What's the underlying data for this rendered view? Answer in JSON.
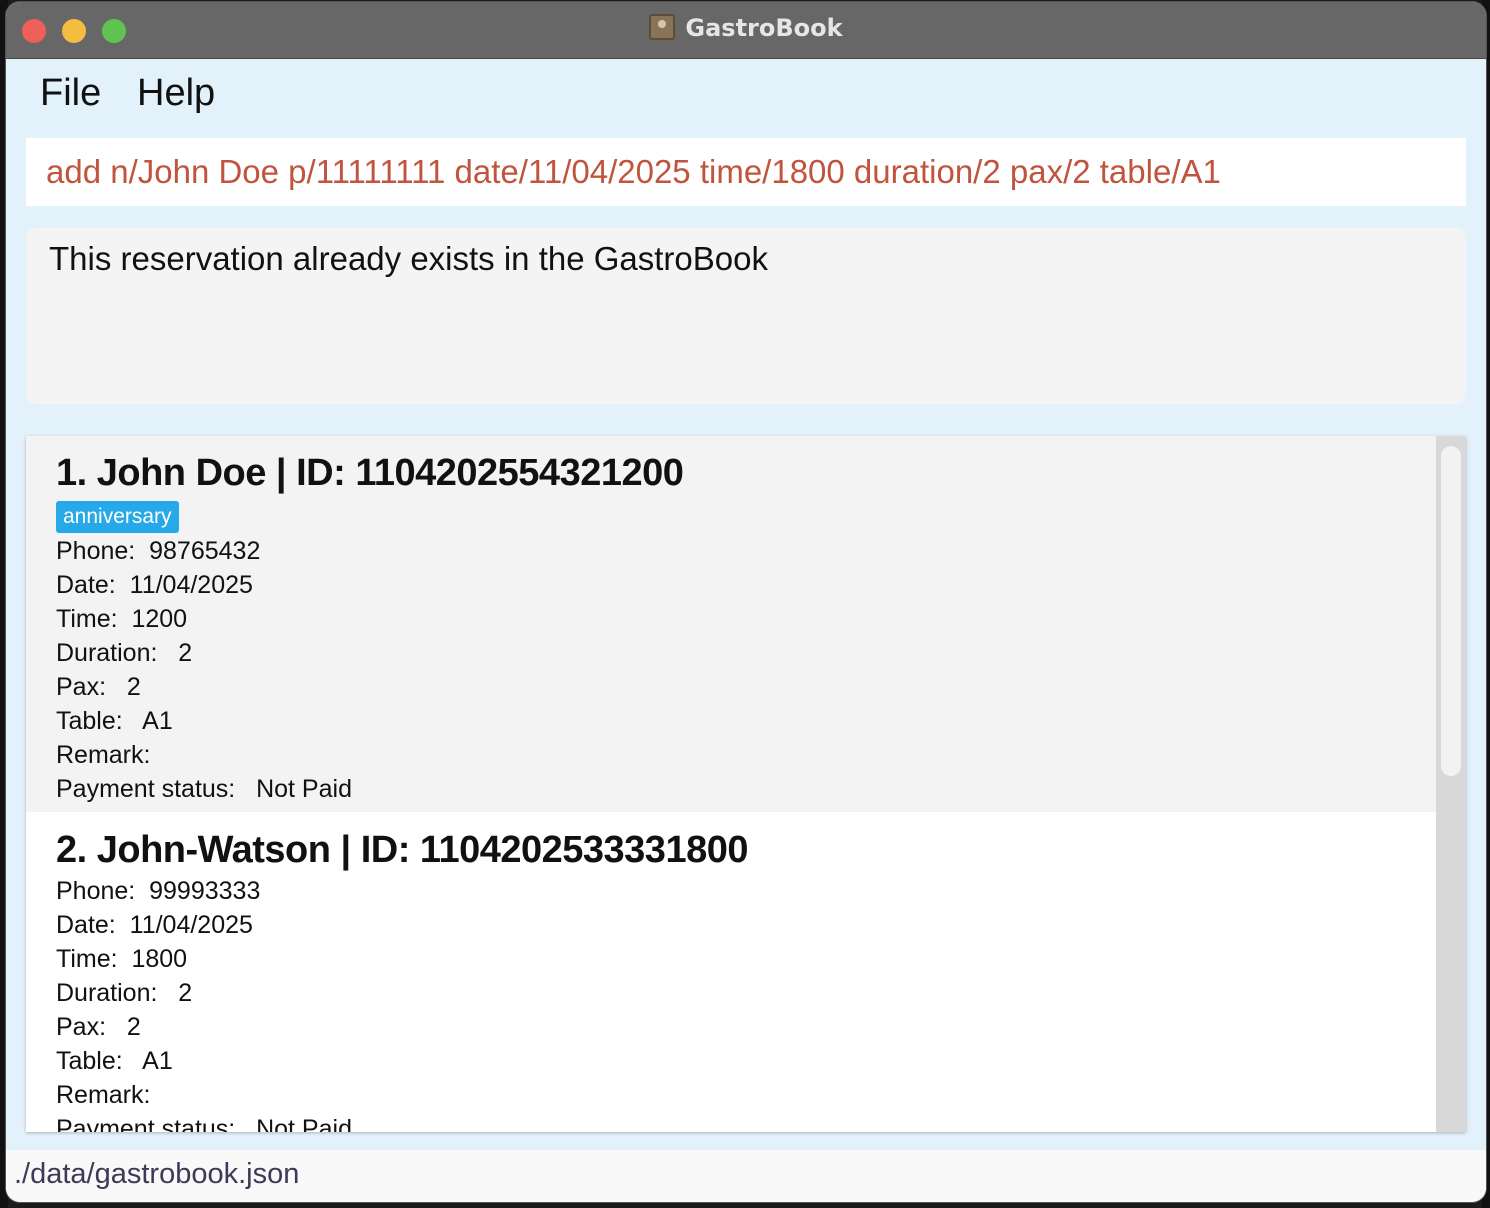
{
  "window": {
    "title": "GastroBook"
  },
  "menu": {
    "file": "File",
    "help": "Help"
  },
  "command": {
    "value": "add n/John Doe p/11111111 date/11/04/2025 time/1800 duration/2 pax/2 table/A1"
  },
  "result": {
    "message": "This reservation already exists in the GastroBook"
  },
  "reservations": [
    {
      "title": "1. John Doe | ID: 1104202554321200",
      "tag": "anniversary",
      "phone": "Phone:  98765432",
      "date": "Date:  11/04/2025",
      "time": "Time:  1200",
      "duration": "Duration:   2",
      "pax": "Pax:   2",
      "table": "Table:   A1",
      "remark": "Remark:",
      "payment": "Payment status:   Not Paid"
    },
    {
      "title": "2. John-Watson | ID: 1104202533331800",
      "phone": "Phone:  99993333",
      "date": "Date:  11/04/2025",
      "time": "Time:  1800",
      "duration": "Duration:   2",
      "pax": "Pax:   2",
      "table": "Table:   A1",
      "remark": "Remark:",
      "payment": "Payment status:   Not Paid"
    }
  ],
  "status": {
    "path": "./data/gastrobook.json"
  },
  "colors": {
    "command_text": "#c0543d",
    "tag_bg": "#27a8e8",
    "window_bg": "#e3f1fb"
  }
}
